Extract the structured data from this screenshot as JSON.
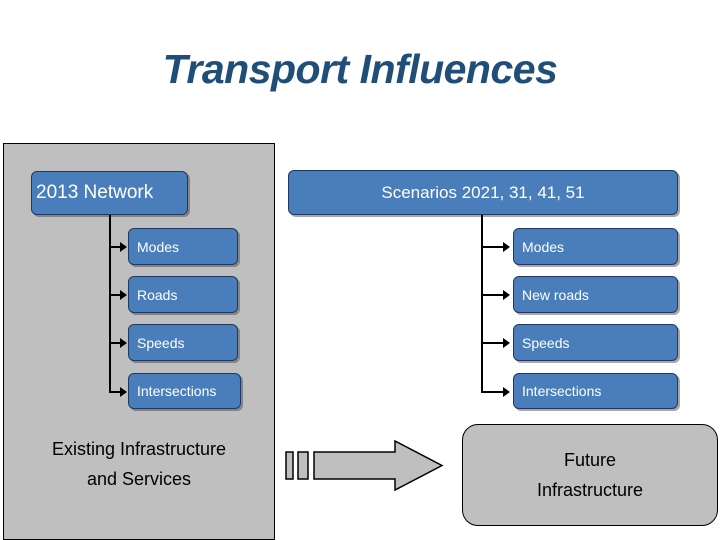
{
  "slide": {
    "title": "Transport Influences",
    "background_color": "#ffffff",
    "title_color": "#1f4e79"
  },
  "left_column": {
    "panel_color": "#bfbfbf",
    "lead_box": {
      "label": "2013 Network"
    },
    "items": [
      {
        "label": "Modes"
      },
      {
        "label": "Roads"
      },
      {
        "label": "Speeds"
      },
      {
        "label": "Intersections"
      }
    ],
    "caption_line1": "Existing Infrastructure",
    "caption_line2": "and Services"
  },
  "right_column": {
    "lead_box": {
      "label": "Scenarios 2021, 31, 41, 51"
    },
    "items": [
      {
        "label": "Modes"
      },
      {
        "label": "New roads"
      },
      {
        "label": "Speeds"
      },
      {
        "label": "Intersections"
      }
    ]
  },
  "bottom": {
    "arrow_icon": "striped-right-arrow-icon",
    "arrow_color": "#bfbfbf",
    "future_box_line1": "Future",
    "future_box_line2": "Infrastructure",
    "future_box_color": "#bfbfbf"
  },
  "palette": {
    "box_blue": "#4a7ebb",
    "box_blue_border": "#1f3864",
    "grey": "#bfbfbf",
    "text_white": "#ffffff",
    "text_black": "#000000"
  }
}
